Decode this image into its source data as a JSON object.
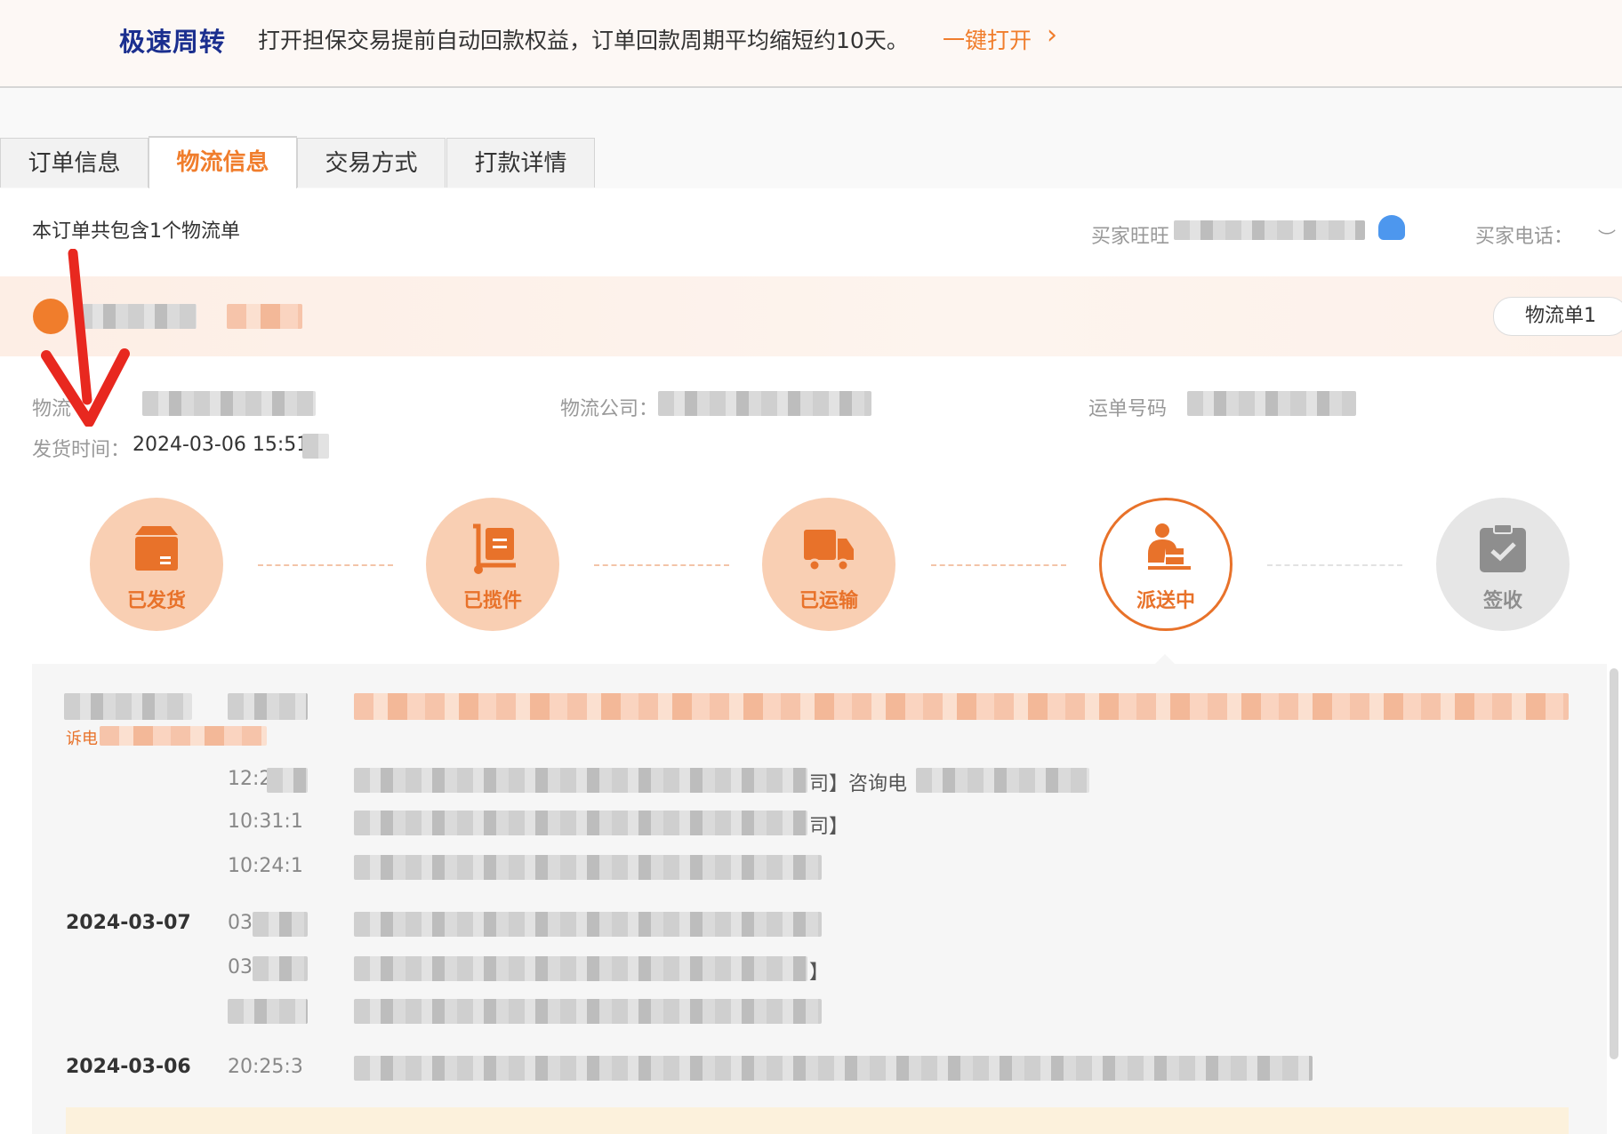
{
  "banner": {
    "brand": "极速周转",
    "text": "打开担保交易提前自动回款权益，订单回款周期平均缩短约10天。",
    "link": "一键打开",
    "chevron": "›"
  },
  "tabs": [
    {
      "label": "订单信息",
      "active": false
    },
    {
      "label": "物流信息",
      "active": true
    },
    {
      "label": "交易方式",
      "active": false
    },
    {
      "label": "打款详情",
      "active": false
    }
  ],
  "summary": "本订单共包含1个物流单",
  "buyer": {
    "wangwang_label": "买家旺旺",
    "phone_label": "买家电话："
  },
  "waybill_button": "物流单1",
  "info": {
    "logistics_label": "物流",
    "company_label": "物流公司：",
    "tracking_label": "运单号码",
    "ship_time_label": "发货时间：",
    "ship_time": "2024-03-06 15:51:"
  },
  "steps": [
    {
      "label": "已发货",
      "state": "done",
      "icon": "box-icon"
    },
    {
      "label": "已揽件",
      "state": "done",
      "icon": "hand-truck-icon"
    },
    {
      "label": "已运输",
      "state": "done",
      "icon": "truck-icon"
    },
    {
      "label": "派送中",
      "state": "current",
      "icon": "courier-icon"
    },
    {
      "label": "签收",
      "state": "pending",
      "icon": "clipboard-check-icon"
    }
  ],
  "tracking": [
    {
      "date": "",
      "time": "",
      "tail": ""
    },
    {
      "date": "",
      "time": "12:2",
      "tail": "司】咨询电"
    },
    {
      "date": "",
      "time": "10:31:1",
      "tail": "司】"
    },
    {
      "date": "",
      "time": "10:24:1",
      "tail": ""
    },
    {
      "date": "2024-03-07",
      "time": "03",
      "tail": ""
    },
    {
      "date": "",
      "time": "03",
      "tail": "】"
    },
    {
      "date": "",
      "time": "",
      "tail": ""
    },
    {
      "date": "2024-03-06",
      "time": "20:25:3",
      "tail": ""
    }
  ],
  "first_entry_sub": "诉电",
  "colors": {
    "accent": "#f07d2c",
    "brand": "#1b2f8f",
    "arrow": "#e8281f"
  }
}
